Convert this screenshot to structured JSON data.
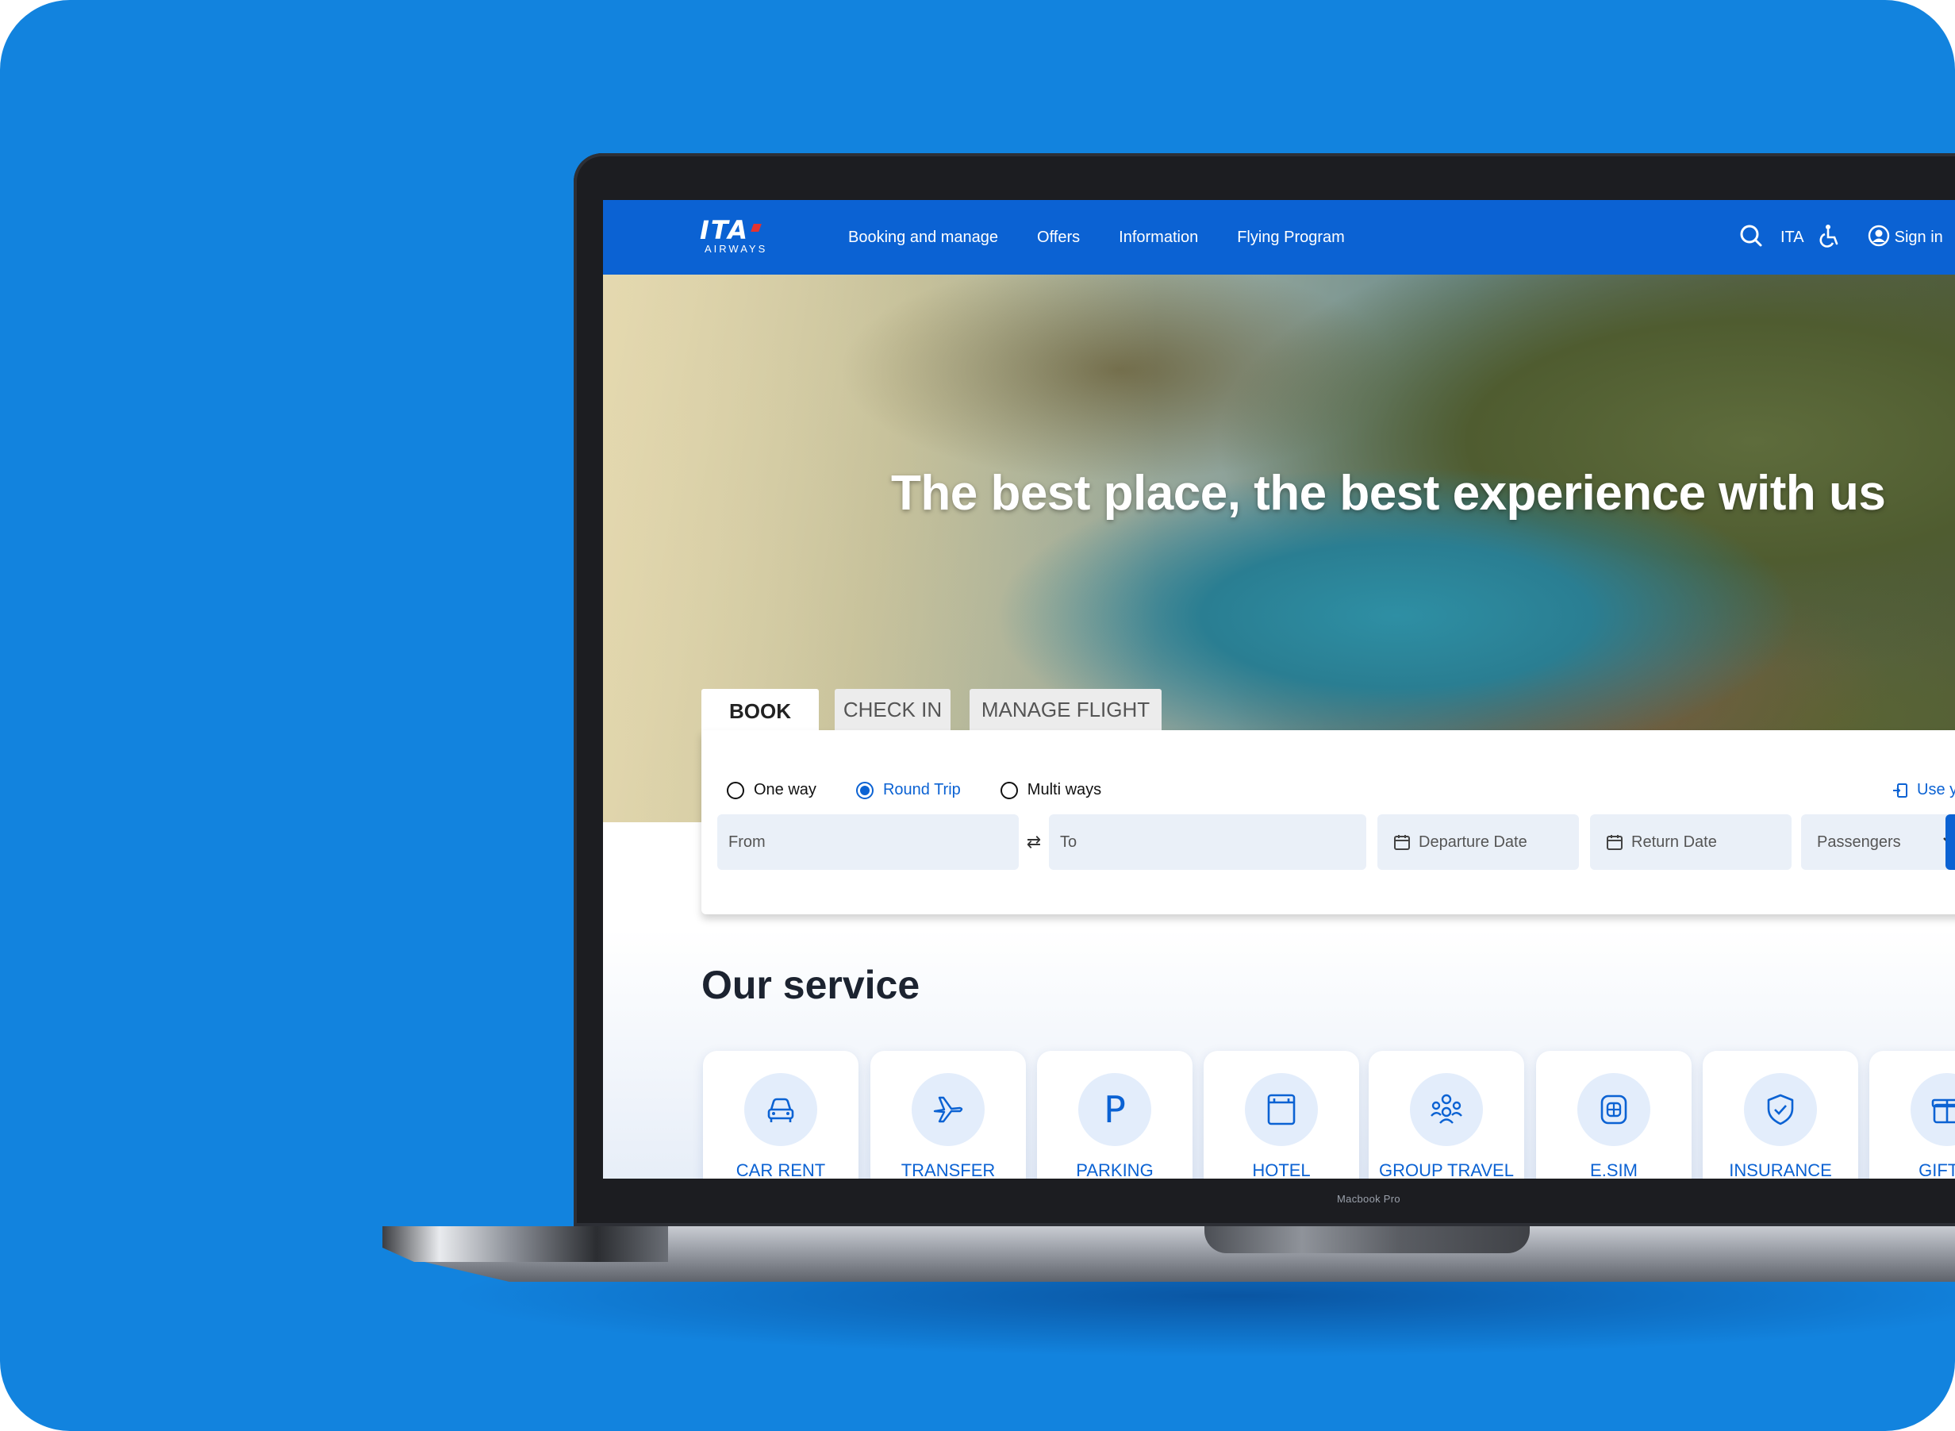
{
  "nav": {
    "logo_main": "ITA",
    "logo_sub": "AIRWAYS",
    "links": [
      "Booking and manage",
      "Offers",
      "Information",
      "Flying Program"
    ],
    "language": "ITA",
    "sign_in": "Sign in"
  },
  "hero": {
    "title": "The best place, the best experience with us"
  },
  "tabs": [
    "BOOK",
    "CHECK IN",
    "MANAGE FLIGHT"
  ],
  "trip_types": {
    "options": [
      "One way",
      "Round Trip",
      "Multi ways"
    ],
    "selected": "Round Trip"
  },
  "volare": "Use your Volare points",
  "fields": {
    "from": "From",
    "to": "To",
    "departure": "Departure Date",
    "return": "Return Date",
    "passengers": "Passengers"
  },
  "services": {
    "title": "Our service",
    "items": [
      {
        "label": "CAR RENT",
        "icon": "car-icon"
      },
      {
        "label": "TRANSFER",
        "icon": "plane-icon"
      },
      {
        "label": "PARKING",
        "icon": "parking-icon"
      },
      {
        "label": "HOTEL",
        "icon": "hotel-icon"
      },
      {
        "label": "GROUP TRAVEL",
        "icon": "group-icon"
      },
      {
        "label": "E.SIM",
        "icon": "sim-icon"
      },
      {
        "label": "INSURANCE",
        "icon": "shield-icon"
      },
      {
        "label": "GIFT C",
        "icon": "gift-icon"
      }
    ]
  },
  "device_label": "Macbook Pro",
  "colors": {
    "background": "#1283de",
    "brand": "#0b62d3",
    "accent": "#e4332f"
  }
}
